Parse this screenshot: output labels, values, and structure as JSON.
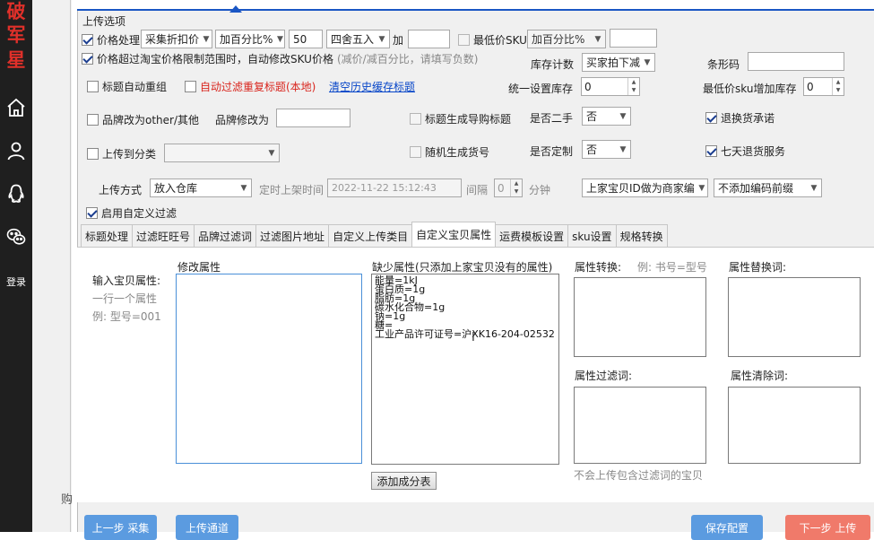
{
  "sidebar": {
    "brand_chars": [
      "破",
      "军",
      "星"
    ],
    "icons": [
      "home-icon",
      "user-icon",
      "qq-icon",
      "wechat-icon"
    ],
    "login_label": "登录"
  },
  "gutter_text": "购",
  "section_title": "上传选项",
  "row_price": {
    "checkbox_label": "价格处理",
    "source_select": "采集折扣价",
    "mode_select": "加百分比%",
    "value": "50",
    "rounding_select": "四舍五入",
    "add_label": "加",
    "add_value": "",
    "min_sku_label": "最低价SKU",
    "min_sku_mode": "加百分比%",
    "min_sku_value": ""
  },
  "row_limit": {
    "checkbox_label": "价格超过淘宝价格限制范围时，自动修改SKU价格",
    "hint": "(减价/减百分比，请填写负数)",
    "stock_count_label": "库存计数",
    "stock_count_select": "买家拍下减",
    "barcode_label": "条形码",
    "barcode_value": ""
  },
  "row_title": {
    "regroup_label": "标题自动重组",
    "dup_filter_label": "自动过滤重复标题(本地)",
    "clear_cache_link": "清空历史缓存标题",
    "unified_stock_label": "统一设置库存",
    "unified_stock_value": "0",
    "min_sku_stock_label": "最低价sku增加库存",
    "min_sku_stock_value": "0"
  },
  "row_brand": {
    "brand_other_label": "品牌改为other/其他",
    "brand_change_label": "品牌修改为",
    "brand_change_value": "",
    "guide_title_label": "标题生成导购标题",
    "second_hand_label": "是否二手",
    "second_hand_value": "否",
    "return_promise_label": "退换货承诺"
  },
  "row_category": {
    "upload_category_label": "上传到分类",
    "category_select": "",
    "random_code_label": "随机生成货号",
    "custom_made_label": "是否定制",
    "custom_made_value": "否",
    "seven_day_label": "七天退货服务"
  },
  "row_upload": {
    "method_label": "上传方式",
    "method_select": "放入仓库",
    "schedule_label": "定时上架时间",
    "schedule_value": "2022-11-22 15:12:43",
    "interval_label": "间隔",
    "interval_value": "0",
    "minutes_label": "分钟",
    "merchant_code_select": "上家宝贝ID做为商家编",
    "prefix_select": "不添加编码前缀"
  },
  "custom_filter_label": "启用自定义过滤",
  "tabs": [
    "标题处理",
    "过滤旺旺号",
    "品牌过滤词",
    "过滤图片地址",
    "自定义上传类目",
    "自定义宝贝属性",
    "运费模板设置",
    "sku设置",
    "规格转换"
  ],
  "tab_page": {
    "input_attr_label": "输入宝贝属性:",
    "one_per_line": "一行一个属性",
    "example": "例: 型号=001",
    "modify_attr_label": "修改属性",
    "missing_attr_label": "缺少属性(只添加上家宝贝没有的属性)",
    "missing_attr_value": "能量=1kJ\n蛋白质=1g\n脂肪=1g\n碳水化合物=1g\n钠=1g\n糖=\n工业产品许可证号=沪XK16-204-02532",
    "add_category_table_button": "添加成分表",
    "attr_convert_label": "属性转换:",
    "attr_convert_hint": "例: 书号=型号",
    "attr_replace_label": "属性替换词:",
    "attr_filter_label": "属性过滤词:",
    "attr_clear_label": "属性清除词:",
    "filter_hint": "不会上传包含过滤词的宝贝"
  },
  "bottom_buttons": {
    "prev": "上一步 采集",
    "upload_channel": "上传通道",
    "save_config": "保存配置",
    "next": "下一步 上传"
  },
  "colors": {
    "brand_red": "#e0302a",
    "accent_blue": "#1a56c4",
    "bottom_blue": "#5b9be0",
    "bottom_red": "#f07a6a"
  }
}
